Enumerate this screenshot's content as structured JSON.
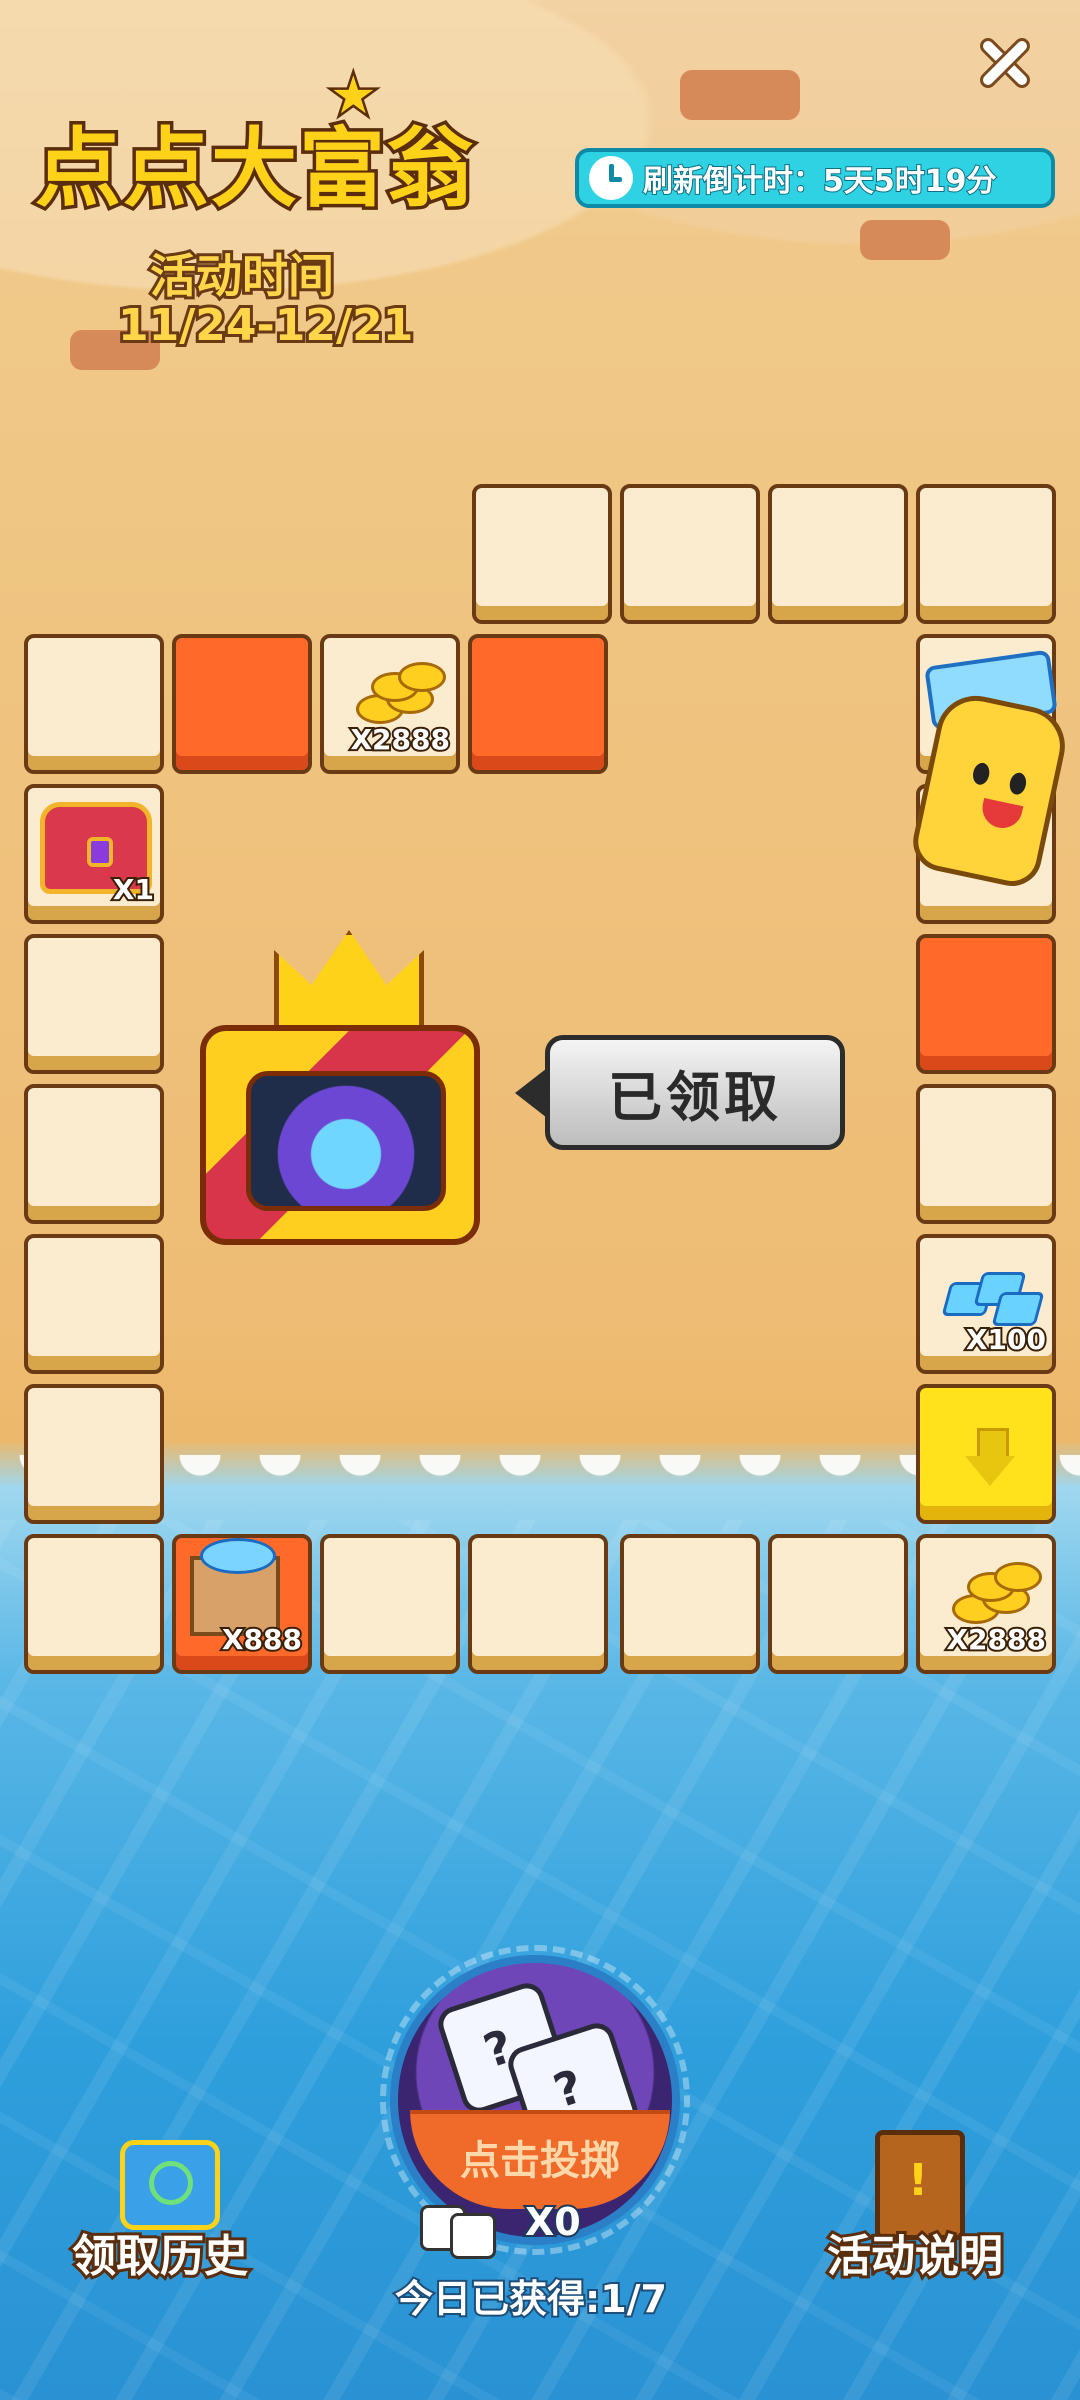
{
  "header": {
    "logo_text": "点点大富翁",
    "activity_time_label": "活动时间",
    "activity_time_range": "11/24-12/21",
    "countdown_text": "刷新倒计时：5天5时19分",
    "close_icon": "close-icon"
  },
  "board": {
    "tiles": {
      "coins_top": "X2888",
      "chest_left": "X1",
      "gems_right": "X100",
      "crate_bottom": "X888",
      "coins_bottom_right": "X2888"
    },
    "colors": {
      "tile": "#fbecd0",
      "red_tile": "#ff6a2a",
      "yellow_tile": "#ffe21c"
    }
  },
  "grand_prize": {
    "status_label": "已领取"
  },
  "dice": {
    "roll_label": "点击投掷",
    "count": "X0",
    "daily_progress": "今日已获得:1/7"
  },
  "footer": {
    "history_label": "领取历史",
    "rules_label": "活动说明"
  }
}
